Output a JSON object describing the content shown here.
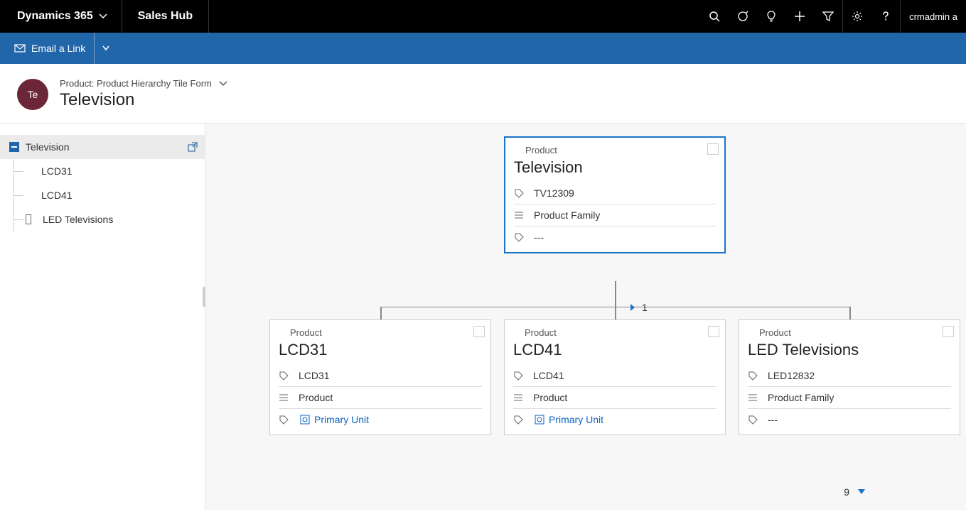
{
  "topnav": {
    "brand": "Dynamics 365",
    "hub": "Sales Hub",
    "user": "crmadmin a"
  },
  "cmdbar": {
    "email_link": "Email a Link"
  },
  "header": {
    "avatar": "Te",
    "breadcrumb": "Product: Product Hierarchy Tile Form",
    "title": "Television"
  },
  "tree": {
    "root": "Television",
    "children": [
      {
        "label": "LCD31",
        "expandable": false
      },
      {
        "label": "LCD41",
        "expandable": false
      },
      {
        "label": "LED Televisions",
        "expandable": true
      }
    ]
  },
  "tiles": {
    "parent": {
      "entity": "Product",
      "title": "Television",
      "code": "TV12309",
      "type": "Product Family",
      "unit": "---"
    },
    "children": [
      {
        "entity": "Product",
        "title": "LCD31",
        "code": "LCD31",
        "type": "Product",
        "unit": "Primary Unit",
        "unit_link": true
      },
      {
        "entity": "Product",
        "title": "LCD41",
        "code": "LCD41",
        "type": "Product",
        "unit": "Primary Unit",
        "unit_link": true
      },
      {
        "entity": "Product",
        "title": "LED Televisions",
        "code": "LED12832",
        "type": "Product Family",
        "unit": "---",
        "unit_link": false
      }
    ],
    "page_mid": "1",
    "page_bottom": "9"
  }
}
